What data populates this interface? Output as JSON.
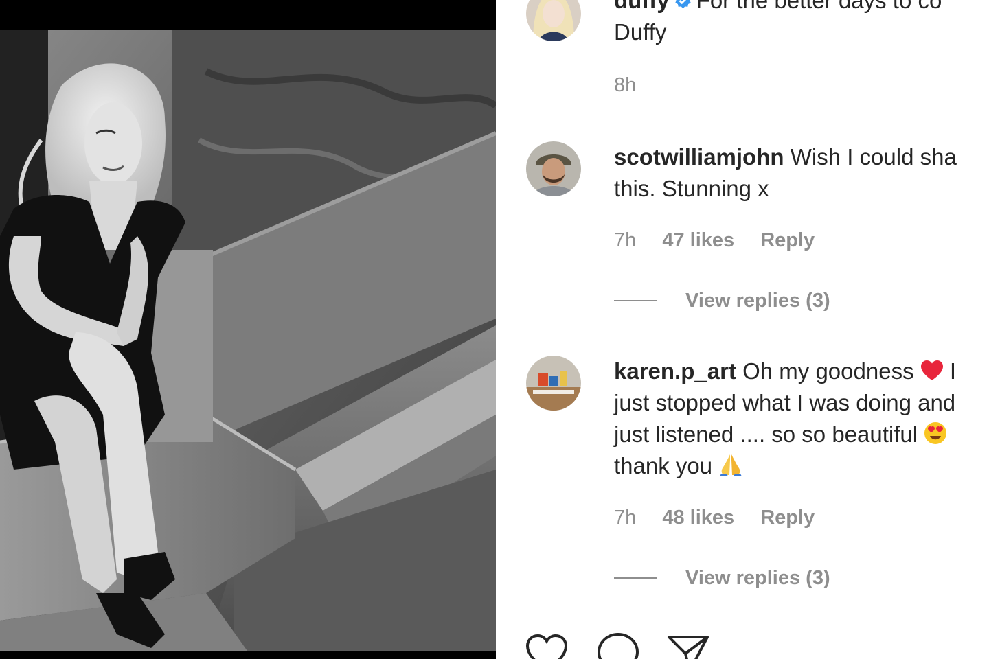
{
  "caption": {
    "username": "duffy",
    "text_line1": "For the better days to co",
    "text_line2": "Duffy",
    "time": "8h"
  },
  "comments": [
    {
      "username": "scotwilliamjohn",
      "text_line1": "Wish I could sha",
      "text_line2": "this. Stunning x",
      "time": "7h",
      "likes": "47 likes",
      "reply": "Reply",
      "view_replies": "View replies (3)"
    },
    {
      "username": "karen.p_art",
      "text_line1": "Oh my goodness",
      "text_line1_tail": "I",
      "text_line2": "just stopped what I was doing and",
      "text_line3": "just listened .... so so beautiful",
      "text_line4": "thank you",
      "time": "7h",
      "likes": "48 likes",
      "reply": "Reply",
      "view_replies": "View replies (3)"
    }
  ],
  "icons": {
    "verified": "verified-badge-icon",
    "heart_emoji": "red-heart-emoji",
    "heart_eyes_emoji": "heart-eyes-emoji",
    "pray_emoji": "folded-hands-emoji",
    "like": "heart-outline-icon",
    "comment": "comment-bubble-icon",
    "share": "paper-plane-icon"
  },
  "colors": {
    "text": "#262626",
    "muted": "#8e8e8e",
    "verified": "#3897f0",
    "divider": "#dbdbdb"
  }
}
